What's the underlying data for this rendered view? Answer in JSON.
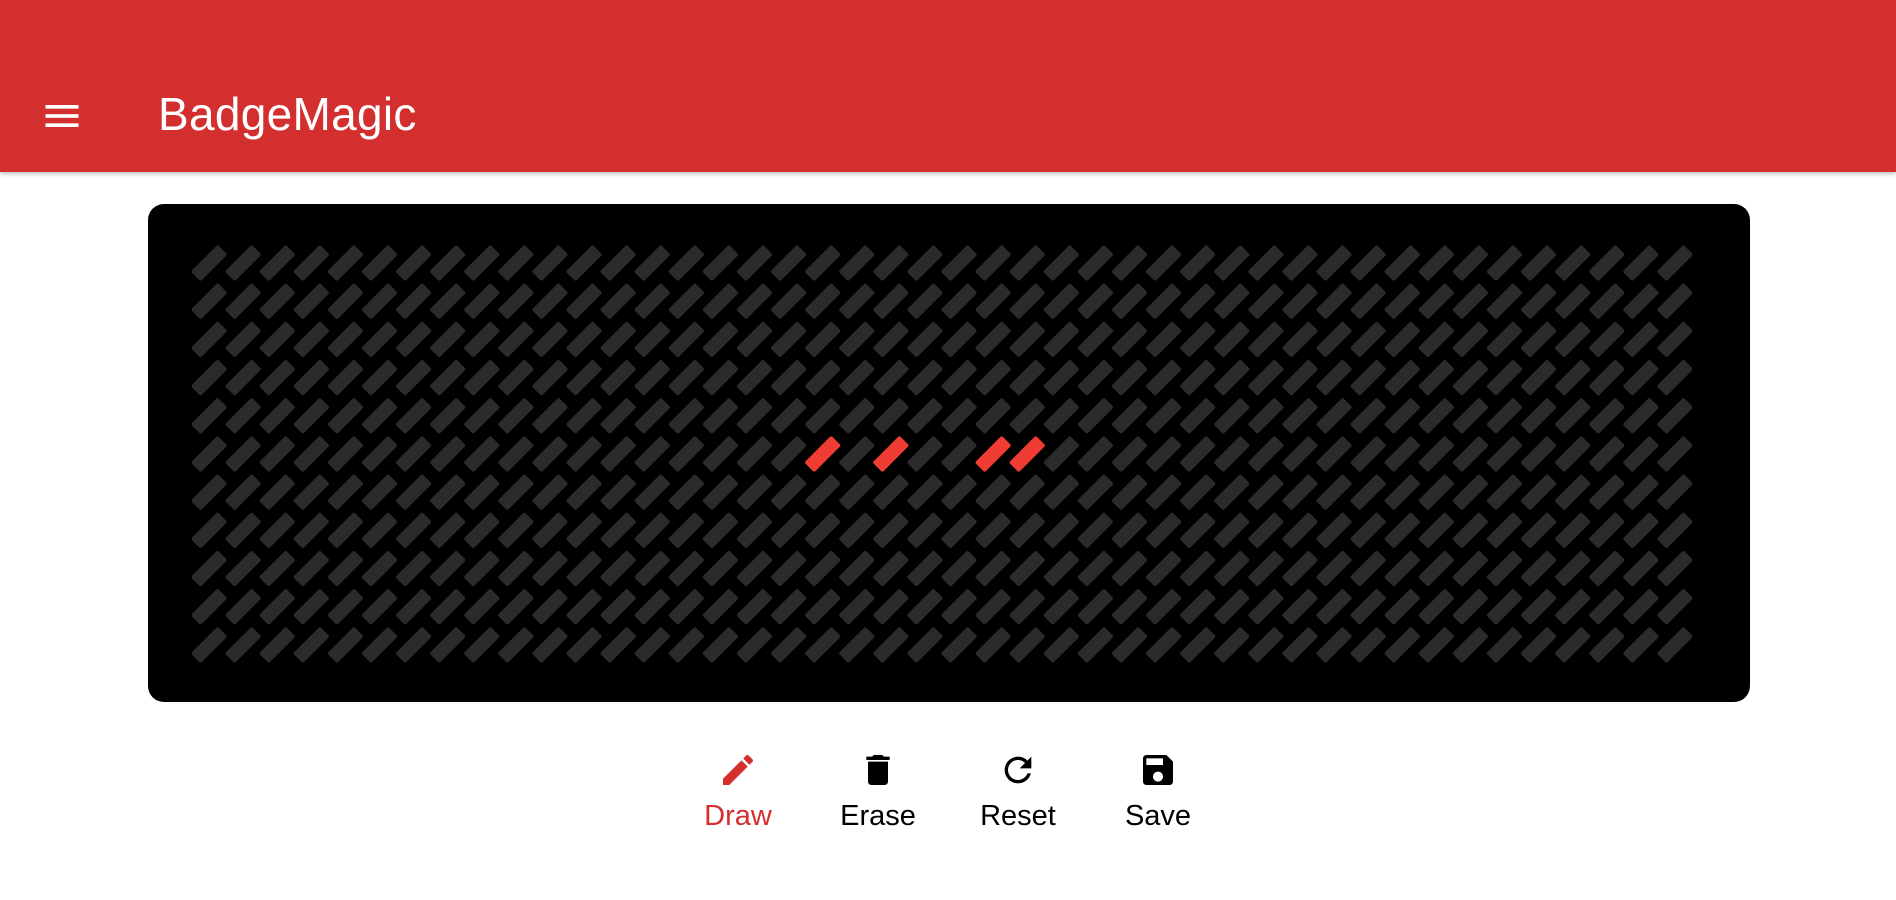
{
  "app_bar": {
    "title": "BadgeMagic",
    "menu_icon": "menu-icon",
    "color": "#d32f2f"
  },
  "badge": {
    "cols": 44,
    "rows": 11,
    "off_color": "#2b2b2b",
    "on_color": "#f03c32",
    "lit_cells": [
      {
        "row": 5,
        "col": 18
      },
      {
        "row": 5,
        "col": 20
      },
      {
        "row": 5,
        "col": 23
      },
      {
        "row": 5,
        "col": 24
      }
    ]
  },
  "toolbar": {
    "active_color": "#d32f2f",
    "tools": [
      {
        "key": "draw",
        "label": "Draw",
        "icon": "pencil-icon",
        "active": true
      },
      {
        "key": "erase",
        "label": "Erase",
        "icon": "trash-icon",
        "active": false
      },
      {
        "key": "reset",
        "label": "Reset",
        "icon": "refresh-icon",
        "active": false
      },
      {
        "key": "save",
        "label": "Save",
        "icon": "save-icon",
        "active": false
      }
    ]
  }
}
